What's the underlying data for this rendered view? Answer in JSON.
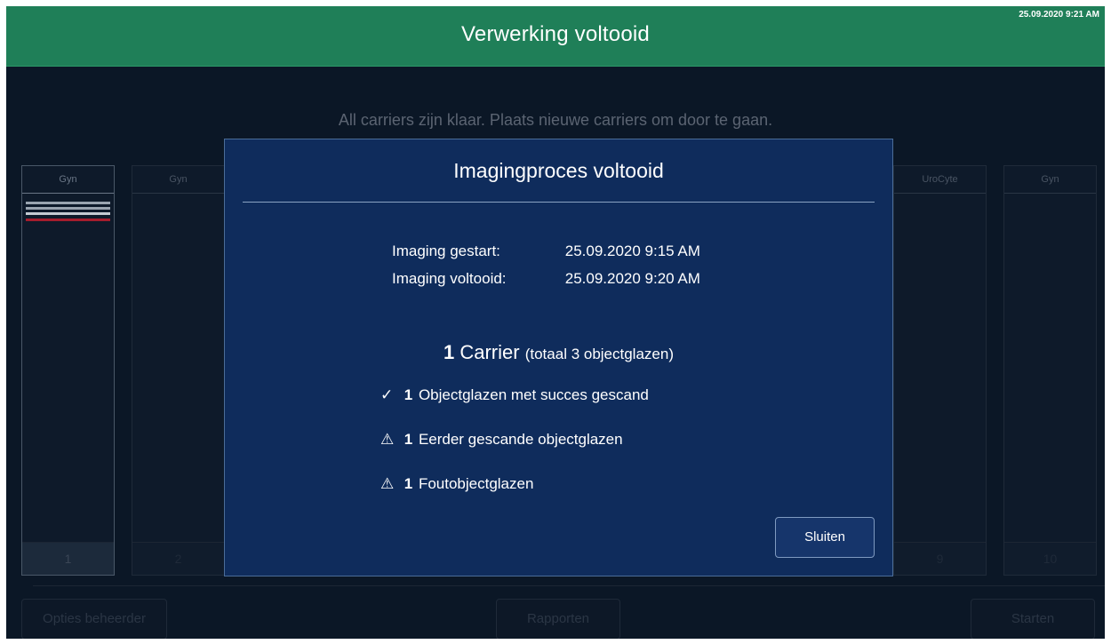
{
  "header": {
    "title": "Verwerking voltooid",
    "clock": "25.09.2020 9:21 AM",
    "background_color": "#1f7f58"
  },
  "status_message": "All carriers zijn klaar. Plaats nieuwe carriers om door te gaan.",
  "carriers": [
    {
      "label": "Gyn",
      "number": "1"
    },
    {
      "label": "Gyn",
      "number": "2"
    },
    {
      "label": "UroCyte",
      "number": "9"
    },
    {
      "label": "Gyn",
      "number": "10"
    }
  ],
  "footer": {
    "admin_button": "Opties beheerder",
    "reports_button": "Rapporten",
    "start_button": "Starten"
  },
  "modal": {
    "title": "Imagingproces voltooid",
    "started_label": "Imaging gestart:",
    "started_value": "25.09.2020 9:15 AM",
    "completed_label": "Imaging voltooid:",
    "completed_value": "25.09.2020 9:20 AM",
    "carrier_count": "1",
    "carrier_word": "Carrier",
    "carrier_detail": "(totaal 3 objectglazen)",
    "results": [
      {
        "icon": "checkmark-icon",
        "count": "1",
        "text": "Objectglazen met succes gescand"
      },
      {
        "icon": "warning-icon",
        "count": "1",
        "text": "Eerder gescande objectglazen"
      },
      {
        "icon": "warning-icon",
        "count": "1",
        "text": "Foutobjectglazen"
      }
    ],
    "close_button": "Sluiten",
    "background_color": "#0f2c5c"
  }
}
